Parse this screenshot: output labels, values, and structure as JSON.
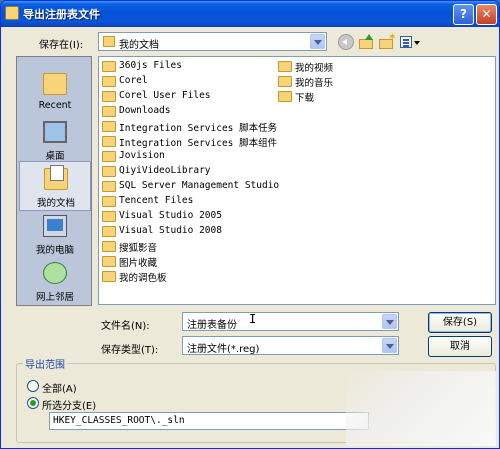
{
  "window": {
    "title": "导出注册表文件",
    "help_glyph": "?",
    "close_glyph": "✕"
  },
  "save_in": {
    "label": "保存在(I):",
    "value": "我的文档"
  },
  "places": [
    {
      "label": "Recent"
    },
    {
      "label": "桌面"
    },
    {
      "label": "我的文档"
    },
    {
      "label": "我的电脑"
    },
    {
      "label": "网上邻居"
    }
  ],
  "files_col1": [
    "360js Files",
    "Corel",
    "Corel User Files",
    "Downloads",
    "Integration Services 脚本任务",
    "Integration Services 脚本组件",
    "Jovision",
    "QiyiVideoLibrary",
    "SQL Server Management Studio",
    "Tencent Files",
    "Visual Studio 2005",
    "Visual Studio 2008",
    "搜狐影音",
    "图片收藏",
    "我的调色板"
  ],
  "files_col2": [
    "我的视频",
    "我的音乐",
    "下载"
  ],
  "filename": {
    "label": "文件名(N):",
    "value": "注册表备份"
  },
  "filetype": {
    "label": "保存类型(T):",
    "value": "注册文件(*.reg)"
  },
  "buttons": {
    "save": "保存(S)",
    "cancel": "取消"
  },
  "export_range": {
    "title": "导出范围",
    "all_label": "全部(A)",
    "selected_label": "所选分支(E)",
    "branch_value": "HKEY_CLASSES_ROOT\\._sln",
    "selected_option": "selected"
  }
}
